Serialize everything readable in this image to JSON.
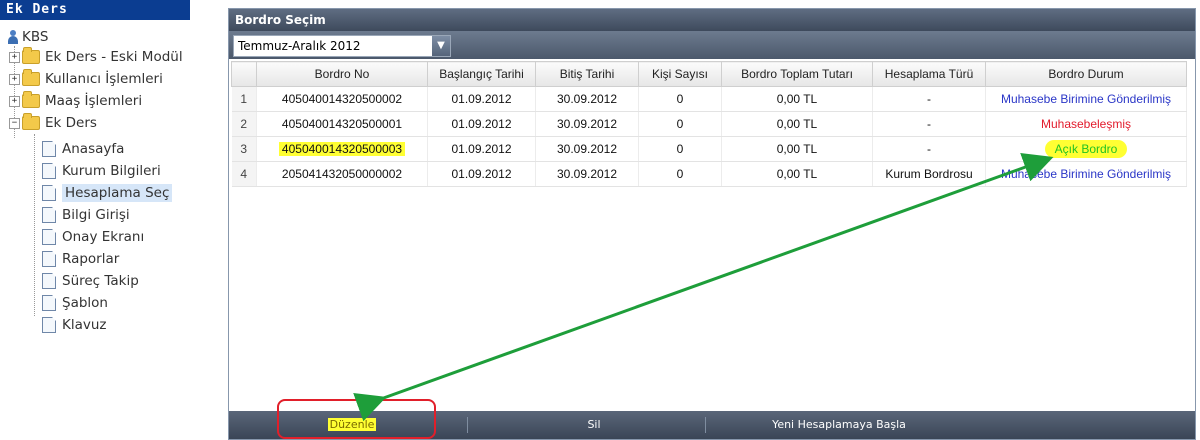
{
  "sidebar": {
    "title": "Ek Ders",
    "root": "KBS",
    "folders": [
      "Ek Ders - Eski Modül",
      "Kullanıcı İşlemleri",
      "Maaş İşlemleri",
      "Ek Ders"
    ],
    "pages": [
      "Anasayfa",
      "Kurum Bilgileri",
      "Hesaplama Seç",
      "Bilgi Girişi",
      "Onay Ekranı",
      "Raporlar",
      "Süreç Takip",
      "Şablon",
      "Klavuz"
    ],
    "selected": "Hesaplama Seç"
  },
  "panel": {
    "title": "Bordro Seçim",
    "period_select": {
      "value": "Temmuz-Aralık 2012"
    },
    "table": {
      "columns": [
        "Bordro No",
        "Başlangıç Tarihi",
        "Bitiş Tarihi",
        "Kişi Sayısı",
        "Bordro Toplam Tutarı",
        "Hesaplama Türü",
        "Bordro Durum"
      ],
      "rows": [
        {
          "num": "1",
          "bordro_no": "405040014320500002",
          "baslangic": "01.09.2012",
          "bitis": "30.09.2012",
          "kisi": "0",
          "tutar": "0,00 TL",
          "tur": "-",
          "durum": "Muhasebe Birimine Gönderilmiş",
          "durum_color": "#2a36c7"
        },
        {
          "num": "2",
          "bordro_no": "405040014320500001",
          "baslangic": "01.09.2012",
          "bitis": "30.09.2012",
          "kisi": "0",
          "tutar": "0,00 TL",
          "tur": "-",
          "durum": "Muhasebeleşmiş",
          "durum_color": "#e21b2c"
        },
        {
          "num": "3",
          "bordro_no": "405040014320500003",
          "baslangic": "01.09.2012",
          "bitis": "30.09.2012",
          "kisi": "0",
          "tutar": "0,00 TL",
          "tur": "-",
          "durum": "Açık Bordro",
          "durum_color": "#22c322"
        },
        {
          "num": "4",
          "bordro_no": "205041432050000002",
          "baslangic": "01.09.2012",
          "bitis": "30.09.2012",
          "kisi": "0",
          "tutar": "0,00 TL",
          "tur": "Kurum Bordrosu",
          "durum": "Muhasebe Birimine Gönderilmiş",
          "durum_color": "#2a36c7"
        }
      ]
    },
    "footer": {
      "edit_label": "Düzenle",
      "delete_label": "Sil",
      "new_calc_label": "Yeni Hesaplamaya Başla"
    }
  },
  "annotation": {
    "arrow_color": "#1e9e3a",
    "box_color": "#e11f2a"
  }
}
